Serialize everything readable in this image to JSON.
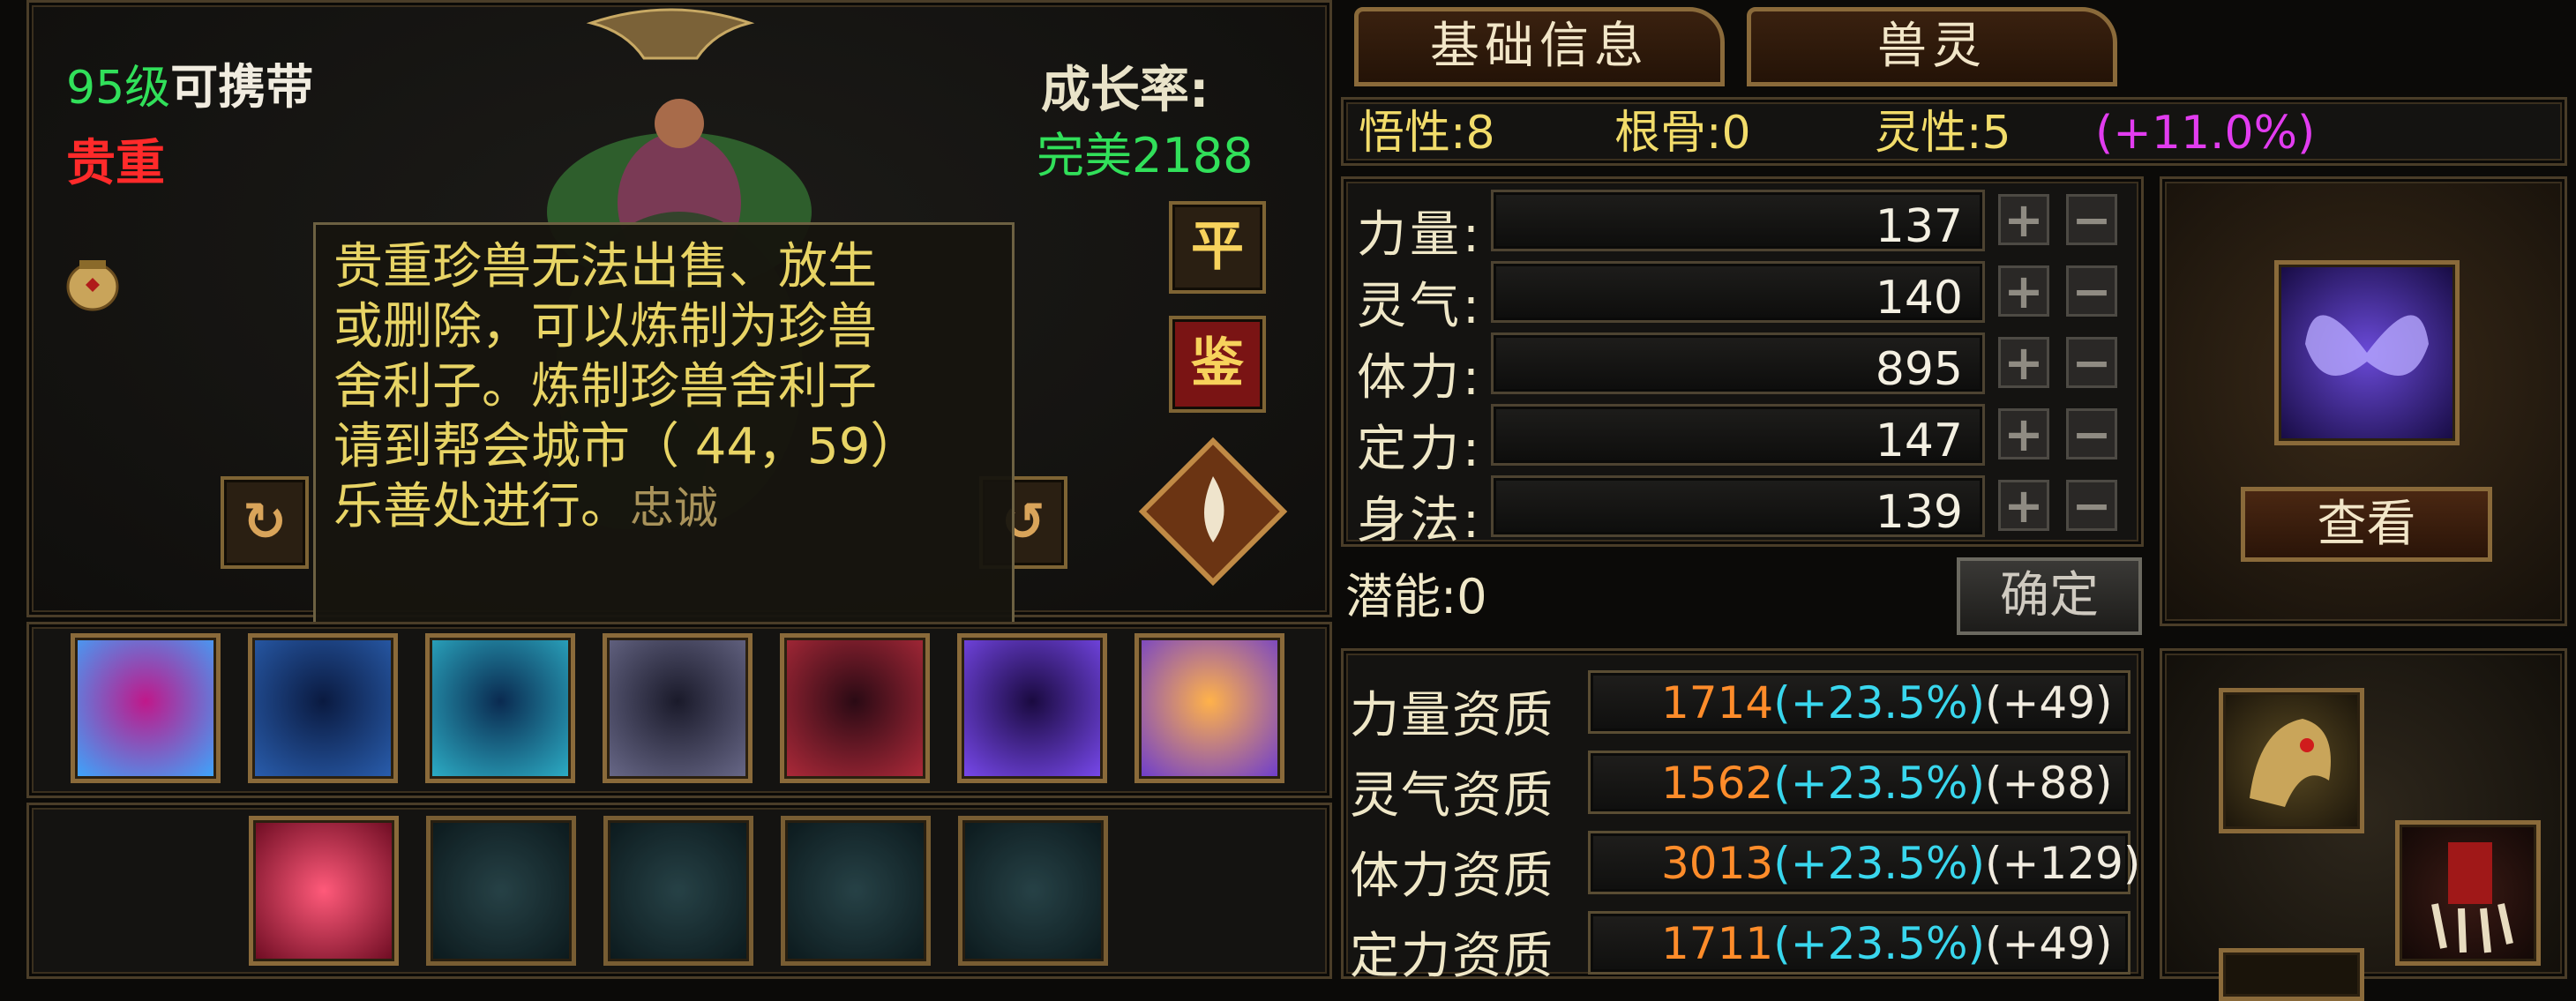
{
  "colors": {
    "gold_border": "#8a6a3a",
    "green_text": "#31e05a",
    "red_text": "#ff2a2a",
    "yellow_text": "#e8d465",
    "magenta_text": "#e23cf0",
    "orange_text": "#ff8c2a",
    "cyan_text": "#39d7ee"
  },
  "pet": {
    "level_text": "95级",
    "carry_text": "可携带",
    "rarity": "贵重",
    "growth_label": "成长率:",
    "growth_value": "完美2188"
  },
  "tooltip": {
    "lines": [
      "贵重珍兽无法出售、放生",
      "或删除，可以炼制为珍兽",
      "舍利子。炼制珍兽舍利子",
      "请到帮会城市（ 44，59）",
      "乐善处进行。"
    ],
    "overlay_text": "忠诚"
  },
  "side_buttons": {
    "ping": "平",
    "jian": "鉴"
  },
  "tabs": [
    "基础信息",
    "兽灵"
  ],
  "traits": {
    "wuxing_label": "悟性:8",
    "gengu_label": "根骨:0",
    "lingxing_label": "灵性:5",
    "bonus": "(+11.0%)"
  },
  "stats": [
    {
      "label": "力量:",
      "value": "137"
    },
    {
      "label": "灵气:",
      "value": "140"
    },
    {
      "label": "体力:",
      "value": "895"
    },
    {
      "label": "定力:",
      "value": "147"
    },
    {
      "label": "身法:",
      "value": "139"
    }
  ],
  "plus": "+",
  "minus": "−",
  "potential_label": "潜能:0",
  "confirm_button": "确定",
  "view_button": "查看",
  "aptitudes": [
    {
      "label": "力量资质",
      "base": "1714",
      "pct": "(+23.5%)",
      "add": "(+49)"
    },
    {
      "label": "灵气资质",
      "base": "1562",
      "pct": "(+23.5%)",
      "add": "(+88)"
    },
    {
      "label": "体力资质",
      "base": "3013",
      "pct": "(+23.5%)",
      "add": "(+129)"
    },
    {
      "label": "定力资质",
      "base": "1711",
      "pct": "(+23.5%)",
      "add": "(+49)"
    }
  ],
  "skills": [
    "skill-icon-1",
    "skill-icon-2",
    "skill-icon-3",
    "skill-icon-4",
    "skill-icon-5",
    "skill-icon-6",
    "skill-icon-7"
  ],
  "bottom_slots": [
    "red-flower-skill-icon",
    "empty-slot-icon",
    "empty-slot-icon",
    "empty-slot-icon",
    "empty-slot-icon"
  ]
}
